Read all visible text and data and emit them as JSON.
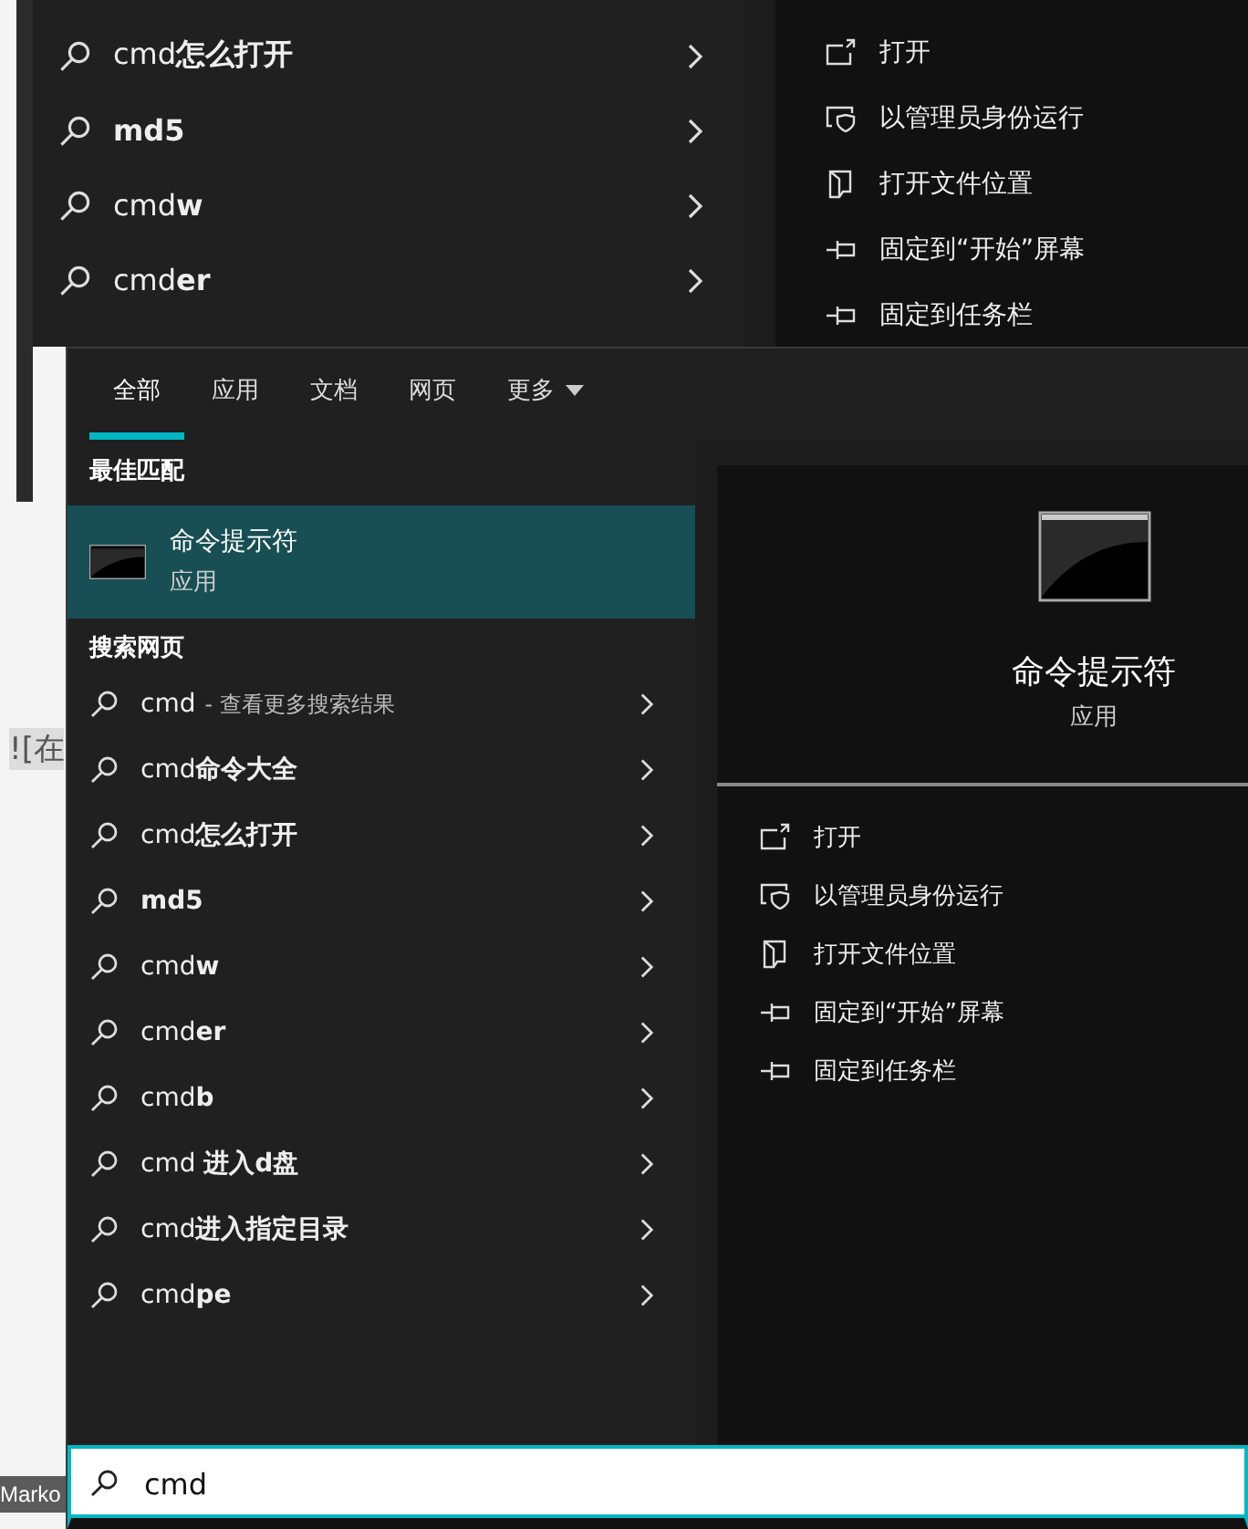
{
  "background_page": {
    "fragment": "![在",
    "taskbar_label": "Marko"
  },
  "previous_search": {
    "suggestions": [
      {
        "text": "cmd**怎么打开**"
      },
      {
        "text": "**md5**"
      },
      {
        "text": "cmd**w**"
      },
      {
        "text": "cmd**er**"
      }
    ],
    "actions": [
      {
        "kind": "open",
        "label": "打开"
      },
      {
        "kind": "admin",
        "label": "以管理员身份运行"
      },
      {
        "kind": "location",
        "label": "打开文件位置"
      },
      {
        "kind": "pin",
        "label": "固定到“开始”屏幕"
      },
      {
        "kind": "pin",
        "label": "固定到任务栏"
      }
    ]
  },
  "tabs": [
    {
      "label": "全部",
      "selected": true
    },
    {
      "label": "应用",
      "selected": false
    },
    {
      "label": "文档",
      "selected": false
    },
    {
      "label": "网页",
      "selected": false
    },
    {
      "label": "更多",
      "selected": false,
      "dropdown": true
    }
  ],
  "best_match": {
    "heading": "最佳匹配",
    "title": "命令提示符",
    "subtitle": "应用",
    "selected": true
  },
  "web_search": {
    "heading": "搜索网页",
    "items": [
      {
        "text": "cmd",
        "hint": "- 查看更多搜索结果"
      },
      {
        "text": "cmd**命令大全**"
      },
      {
        "text": "cmd**怎么打开**"
      },
      {
        "text": "**md5**"
      },
      {
        "text": "cmd**w**"
      },
      {
        "text": "cmd**er**"
      },
      {
        "text": "cmd**b**"
      },
      {
        "text": "cmd **进入d盘**"
      },
      {
        "text": "cmd**进入指定目录**"
      },
      {
        "text": "cmd**pe**"
      }
    ]
  },
  "preview": {
    "title": "命令提示符",
    "subtitle": "应用",
    "actions": [
      {
        "kind": "open",
        "label": "打开"
      },
      {
        "kind": "admin",
        "label": "以管理员身份运行"
      },
      {
        "kind": "location",
        "label": "打开文件位置"
      },
      {
        "kind": "pin",
        "label": "固定到“开始”屏幕"
      },
      {
        "kind": "pin",
        "label": "固定到任务栏"
      }
    ]
  },
  "search": {
    "value": "cmd"
  }
}
